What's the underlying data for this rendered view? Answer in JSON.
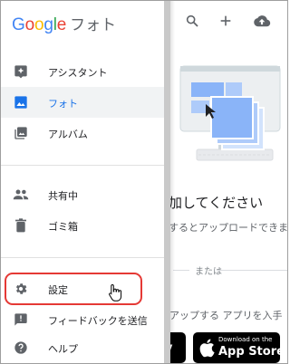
{
  "brand": {
    "google": "Google",
    "product": "フォト"
  },
  "drawer": {
    "items": [
      {
        "label": "アシスタント",
        "icon": "assistant-icon",
        "active": false
      },
      {
        "label": "フォト",
        "icon": "photo-icon",
        "active": true
      },
      {
        "label": "アルバム",
        "icon": "album-icon",
        "active": false
      },
      {
        "label": "共有中",
        "icon": "people-icon",
        "active": false
      },
      {
        "label": "ゴミ箱",
        "icon": "trash-icon",
        "active": false
      },
      {
        "label": "設定",
        "icon": "gear-icon",
        "active": false
      },
      {
        "label": "フィードバックを送信",
        "icon": "feedback-icon",
        "active": false
      },
      {
        "label": "ヘルプ",
        "icon": "help-icon",
        "active": false
      }
    ]
  },
  "main": {
    "add_title": "加してください",
    "add_subtitle": "するとアップロードできま",
    "or_text": "または",
    "app_subtitle": "アップする アプリを入手",
    "store": {
      "play_text": "y",
      "apple_small": "Download on the",
      "apple_big": "App Store"
    }
  },
  "colors": {
    "accent": "#1a73e8",
    "highlight": "#e53935",
    "icon": "#5f6368"
  }
}
